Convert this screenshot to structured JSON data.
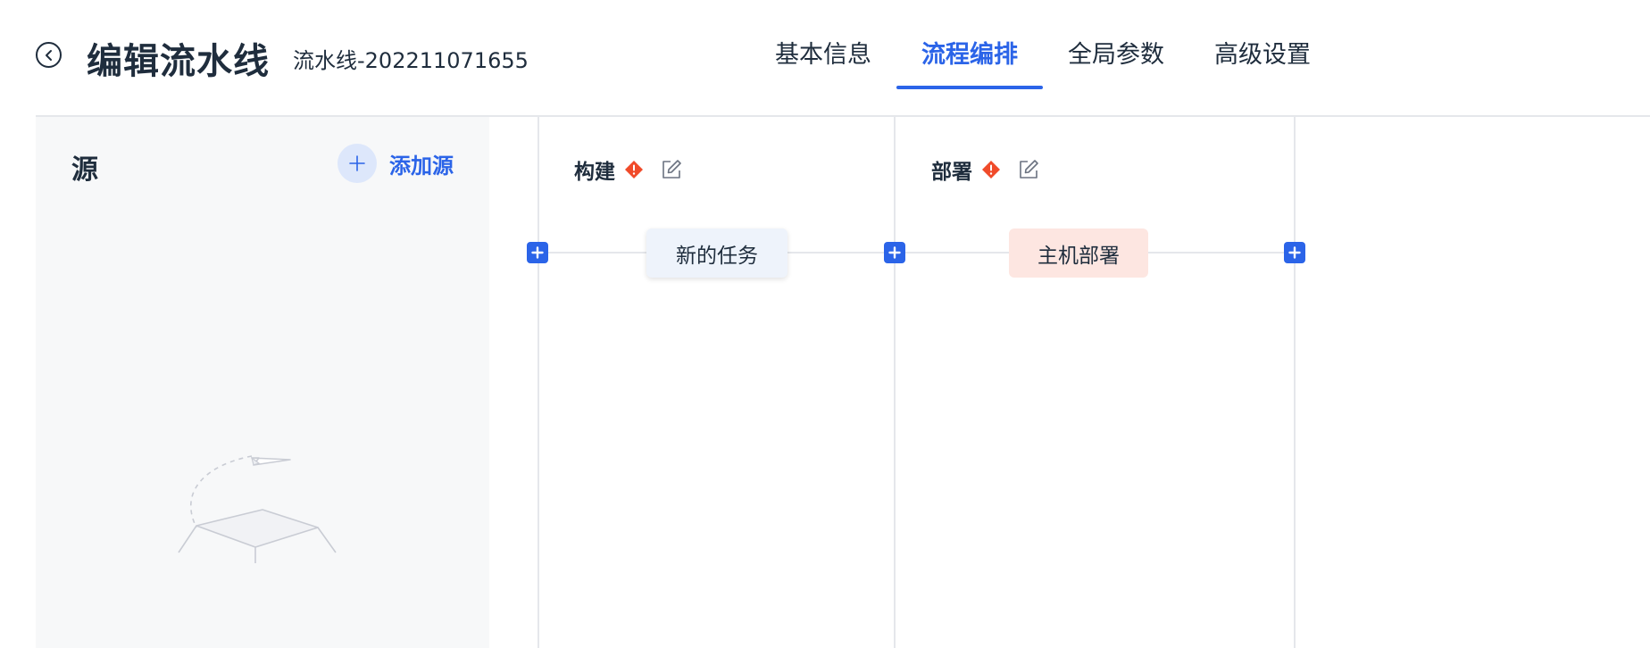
{
  "header": {
    "title": "编辑流水线",
    "subtitle": "流水线-202211071655",
    "tabs": [
      {
        "label": "基本信息",
        "active": false
      },
      {
        "label": "流程编排",
        "active": true
      },
      {
        "label": "全局参数",
        "active": false
      },
      {
        "label": "高级设置",
        "active": false
      }
    ]
  },
  "source": {
    "title": "源",
    "add_label": "添加源"
  },
  "stages": [
    {
      "name": "构建",
      "jobs": [
        "新的任务"
      ]
    },
    {
      "name": "部署",
      "jobs": [
        "主机部署"
      ]
    }
  ],
  "colors": {
    "accent": "#2b64e8",
    "warning": "#f04b2a",
    "job_default_bg": "#eef3fb",
    "job_error_bg": "#fde6e1",
    "panel_bg": "#f7f8f9"
  },
  "icons": {
    "back": "chevron-left-icon",
    "add": "plus-icon",
    "warning": "warning-icon",
    "edit": "edit-icon"
  }
}
